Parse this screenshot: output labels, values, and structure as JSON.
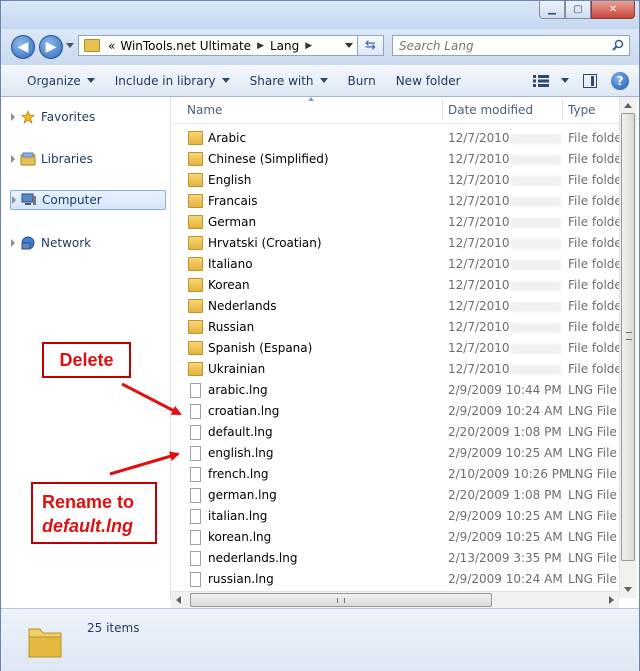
{
  "address": {
    "chevron": "«",
    "path": [
      "WinTools.net Ultimate",
      "Lang"
    ]
  },
  "search": {
    "placeholder": "Search Lang"
  },
  "toolbar": {
    "organize": "Organize",
    "include_in_library": "Include in library",
    "share_with": "Share with",
    "burn": "Burn",
    "new_folder": "New folder"
  },
  "nav": {
    "favorites": "Favorites",
    "libraries": "Libraries",
    "computer": "Computer",
    "network": "Network"
  },
  "columns": {
    "name": "Name",
    "date": "Date modified",
    "type": "Type"
  },
  "folders": [
    {
      "name": "Arabic",
      "date": "12/7/2010",
      "type": "File folde"
    },
    {
      "name": "Chinese (Simplified)",
      "date": "12/7/2010",
      "type": "File folde"
    },
    {
      "name": "English",
      "date": "12/7/2010",
      "type": "File folde"
    },
    {
      "name": "Francais",
      "date": "12/7/2010",
      "type": "File folde"
    },
    {
      "name": "German",
      "date": "12/7/2010",
      "type": "File folde"
    },
    {
      "name": "Hrvatski (Croatian)",
      "date": "12/7/2010",
      "type": "File folde"
    },
    {
      "name": "Italiano",
      "date": "12/7/2010",
      "type": "File folde"
    },
    {
      "name": "Korean",
      "date": "12/7/2010",
      "type": "File folde"
    },
    {
      "name": "Nederlands",
      "date": "12/7/2010",
      "type": "File folde"
    },
    {
      "name": "Russian",
      "date": "12/7/2010",
      "type": "File folde"
    },
    {
      "name": "Spanish (Espana)",
      "date": "12/7/2010",
      "type": "File folde"
    },
    {
      "name": "Ukrainian",
      "date": "12/7/2010",
      "type": "File folde"
    }
  ],
  "files": [
    {
      "name": "arabic.lng",
      "date": "2/9/2009 10:44 PM",
      "type": "LNG File"
    },
    {
      "name": "croatian.lng",
      "date": "2/9/2009 10:24 AM",
      "type": "LNG File"
    },
    {
      "name": "default.lng",
      "date": "2/20/2009 1:08 PM",
      "type": "LNG File"
    },
    {
      "name": "english.lng",
      "date": "2/9/2009 10:25 AM",
      "type": "LNG File"
    },
    {
      "name": "french.lng",
      "date": "2/10/2009 10:26 PM",
      "type": "LNG File"
    },
    {
      "name": "german.lng",
      "date": "2/20/2009 1:08 PM",
      "type": "LNG File"
    },
    {
      "name": "italian.lng",
      "date": "2/9/2009 10:25 AM",
      "type": "LNG File"
    },
    {
      "name": "korean.lng",
      "date": "2/9/2009 10:25 AM",
      "type": "LNG File"
    },
    {
      "name": "nederlands.lng",
      "date": "2/13/2009 3:35 PM",
      "type": "LNG File"
    },
    {
      "name": "russian.lng",
      "date": "2/9/2009 10:24 AM",
      "type": "LNG File"
    }
  ],
  "status": {
    "item_count": "25 items"
  },
  "annotations": {
    "delete": "Delete",
    "rename_line1": "Rename to",
    "rename_line2": "default.lng",
    "color": "#e01010"
  },
  "colors": {
    "folder": "#e8c050",
    "accent": "#2f69b8",
    "annotation_border": "#c00000"
  }
}
